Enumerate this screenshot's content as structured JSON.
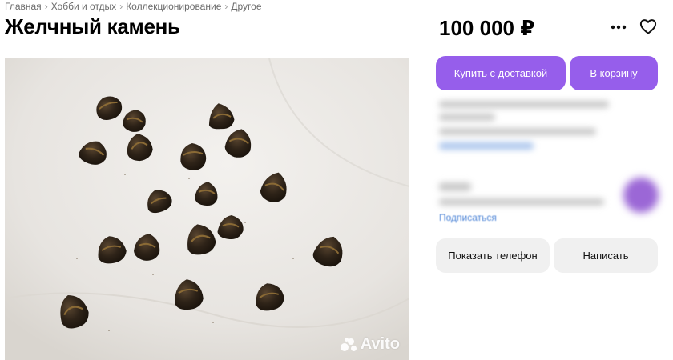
{
  "breadcrumb": [
    "Главная",
    "Хобби и отдых",
    "Коллекционирование",
    "Другое"
  ],
  "breadcrumb_separator": "›",
  "listing": {
    "title": "Желчный камень",
    "price": "100 000 ₽"
  },
  "photo": {
    "watermark": "Avito",
    "colors": {
      "background": "#e9e6e2",
      "stone": "#2e2318",
      "stone_band": "#8a6a35"
    }
  },
  "actions": {
    "buy_label": "Купить с доставкой",
    "cart_label": "В корзину",
    "phone_label": "Показать телефон",
    "write_label": "Написать"
  },
  "seller": {
    "subscribe_label": "Подписаться"
  },
  "icons": [
    "more-icon",
    "heart-icon"
  ],
  "colors": {
    "accent": "#965eeb",
    "secondary_button": "#f0f0f0",
    "link": "#4d84d6",
    "muted_text": "#6b6b6b"
  }
}
